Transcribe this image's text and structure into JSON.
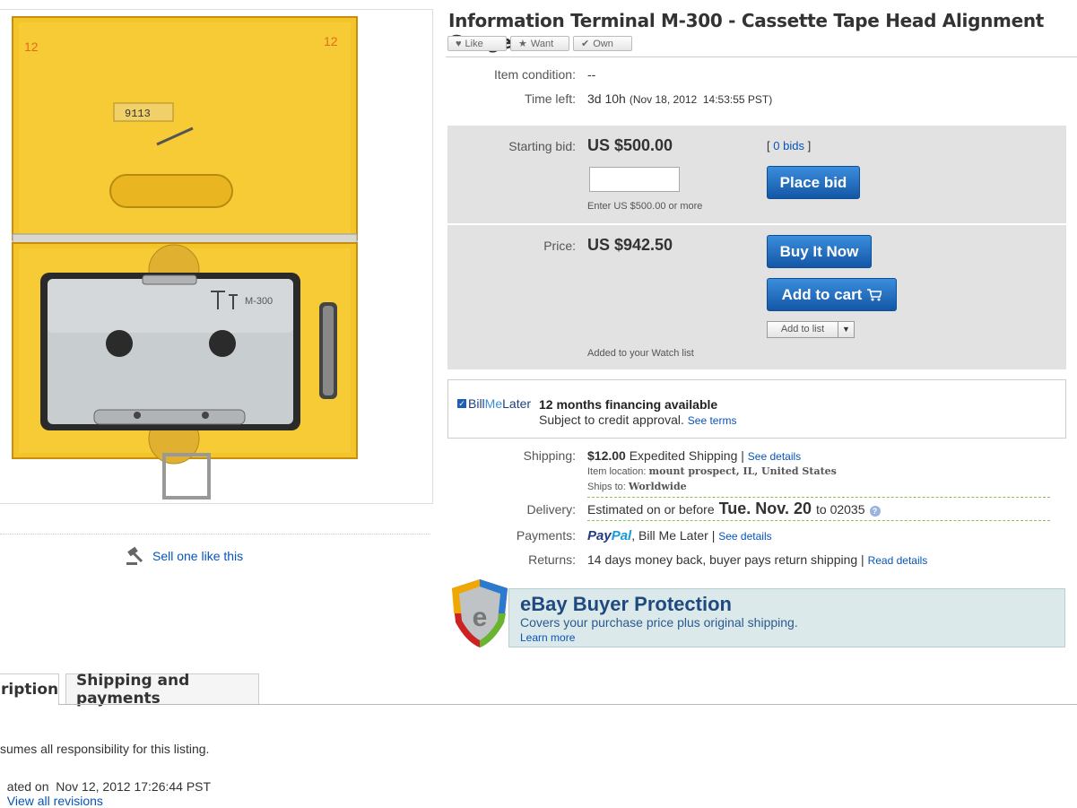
{
  "listing": {
    "title": "Information Terminal M-300 - Cassette Tape Head Alignment Gauge"
  },
  "social": {
    "like": "Like",
    "want": "Want",
    "own": "Own"
  },
  "image": {
    "box_marking_left": "12",
    "box_marking_right": "12",
    "tag_text": "9113",
    "logo_text": "M-300"
  },
  "details": {
    "condition_label": "Item condition:",
    "condition_value": "--",
    "time_label": "Time left:",
    "time_value": "3d 10h",
    "time_detail": "(Nov 18, 2012  14:53:55 PST)"
  },
  "bid": {
    "label": "Starting bid:",
    "value": "US $500.00",
    "bids_open": "[",
    "bids_link": "0 bids",
    "bids_close": "]",
    "input_placeholder": "",
    "hint": "Enter US $500.00 or more",
    "button": "Place bid"
  },
  "buy": {
    "label": "Price:",
    "value": "US $942.50",
    "buy_now": "Buy It Now",
    "add_cart": "Add to cart",
    "add_list": "Add to list",
    "watch_note": "Added to your Watch list"
  },
  "bml": {
    "logo_a": "Bill",
    "logo_b": "Me",
    "logo_c": "Later",
    "headline": "12 months financing available",
    "sub": "Subject to credit approval.",
    "terms": "See terms"
  },
  "shipping": {
    "label": "Shipping:",
    "cost": "$12.00",
    "method": "Expedited Shipping |",
    "details_link": "See details",
    "location_label": "Item location:",
    "location": "mount prospect, IL, United States",
    "ships_label": "Ships to:",
    "ships": "Worldwide"
  },
  "delivery": {
    "label": "Delivery:",
    "prefix": "Estimated on or before",
    "date": "Tue. Nov. 20",
    "suffix": "to 02035"
  },
  "payments": {
    "label": "Payments:",
    "paypal_a": "Pay",
    "paypal_b": "Pal",
    "other": ", Bill Me Later |",
    "link": "See details"
  },
  "returns": {
    "label": "Returns:",
    "text": "14 days money back, buyer pays return shipping |",
    "link": "Read details"
  },
  "protection": {
    "title": "eBay Buyer Protection",
    "sub": "Covers your purchase price plus original shipping.",
    "link": "Learn more",
    "shield_letter": "e"
  },
  "sell": {
    "label": "Sell one like this"
  },
  "tabs": {
    "description": "ription",
    "shipping": "Shipping and payments"
  },
  "footer": {
    "line1": "sumes all responsibility for this listing.",
    "line2": "ated on  Nov 12, 2012 17:26:44 PST",
    "revisions": "View all revisions"
  },
  "colors": {
    "accent_blue": "#0654ba",
    "button_blue": "#1a5fb4",
    "panel_gray": "#e2e2e2",
    "case_yellow": "#f6c51a"
  }
}
